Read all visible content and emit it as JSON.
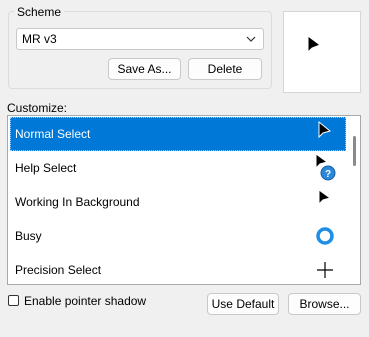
{
  "scheme": {
    "group_label": "Scheme",
    "selected": "MR v3",
    "save_as_label": "Save As...",
    "delete_label": "Delete"
  },
  "preview_icon": "arrow-pointer-icon",
  "customize_label": "Customize:",
  "pointers": [
    {
      "label": "Normal Select",
      "icon": "arrow-pointer-icon",
      "selected": true
    },
    {
      "label": "Help Select",
      "icon": "help-pointer-icon",
      "selected": false
    },
    {
      "label": "Working In Background",
      "icon": "working-pointer-icon",
      "selected": false
    },
    {
      "label": "Busy",
      "icon": "busy-ring-icon",
      "selected": false
    },
    {
      "label": "Precision Select",
      "icon": "crosshair-icon",
      "selected": false
    }
  ],
  "shadow": {
    "label": "Enable pointer shadow",
    "checked": false
  },
  "buttons": {
    "use_default_label": "Use Default",
    "browse_label": "Browse..."
  },
  "colors": {
    "accent": "#0078d7",
    "busy_ring": "#1e8fe8"
  }
}
